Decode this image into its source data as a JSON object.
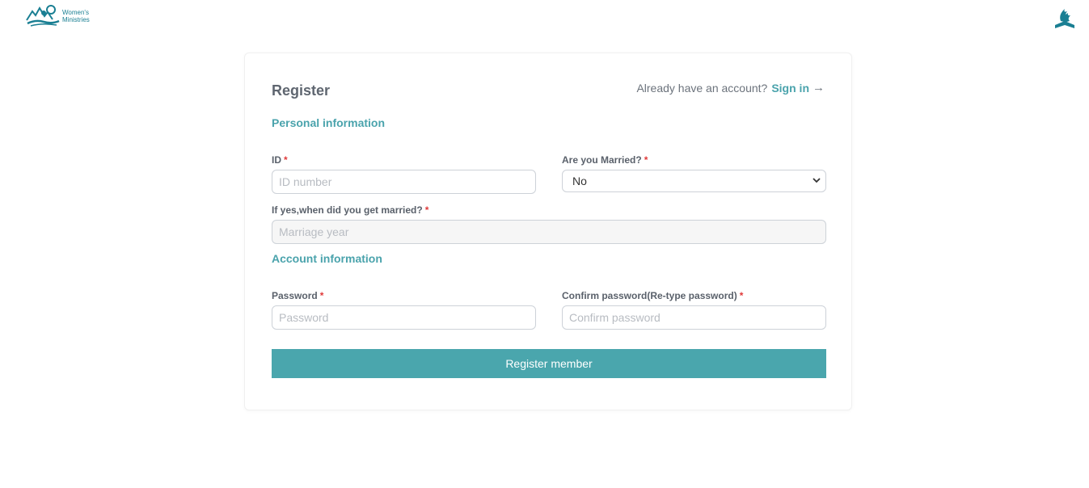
{
  "header": {
    "logo_line1": "Women's",
    "logo_line2": "Ministries",
    "left_logo_icon": "womens-ministries-logo-icon",
    "right_logo_icon": "adventist-flame-icon"
  },
  "form": {
    "title": "Register",
    "already_text": "Already have an account?",
    "signin_label": "Sign in",
    "signin_arrow": "→",
    "personal_section": "Personal information",
    "id_label": "ID",
    "id_placeholder": "ID number",
    "married_label": "Are you Married?",
    "married_value": "No",
    "marriage_year_label": "If yes,when did you get married?",
    "marriage_year_placeholder": "Marriage year",
    "account_section": "Account information",
    "password_label": "Password",
    "password_placeholder": "Password",
    "confirm_label": "Confirm password(Re-type password)",
    "confirm_placeholder": "Confirm password",
    "required_mark": "*",
    "submit_label": "Register member"
  },
  "colors": {
    "accent": "#4aa6ad",
    "brand_teal": "#1a7f93",
    "required": "#e03a3a"
  }
}
